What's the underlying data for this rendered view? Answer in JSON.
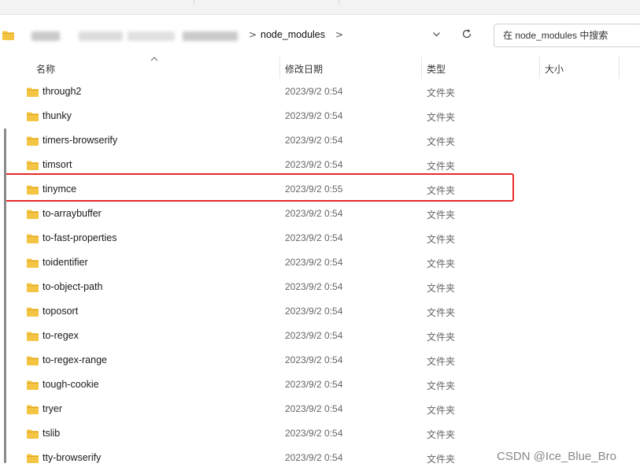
{
  "address": {
    "breadcrumb_current": "node_modules",
    "separator": ">",
    "dropdown_icon": "chevron-down-icon",
    "refresh_icon": "refresh-icon"
  },
  "search": {
    "placeholder": "在 node_modules 中搜索"
  },
  "columns": {
    "name": "名称",
    "modified": "修改日期",
    "type": "类型",
    "size": "大小"
  },
  "files": [
    {
      "name": "through2",
      "modified": "2023/9/2 0:54",
      "type": "文件夹"
    },
    {
      "name": "thunky",
      "modified": "2023/9/2 0:54",
      "type": "文件夹"
    },
    {
      "name": "timers-browserify",
      "modified": "2023/9/2 0:54",
      "type": "文件夹"
    },
    {
      "name": "timsort",
      "modified": "2023/9/2 0:54",
      "type": "文件夹"
    },
    {
      "name": "tinymce",
      "modified": "2023/9/2 0:55",
      "type": "文件夹"
    },
    {
      "name": "to-arraybuffer",
      "modified": "2023/9/2 0:54",
      "type": "文件夹"
    },
    {
      "name": "to-fast-properties",
      "modified": "2023/9/2 0:54",
      "type": "文件夹"
    },
    {
      "name": "toidentifier",
      "modified": "2023/9/2 0:54",
      "type": "文件夹"
    },
    {
      "name": "to-object-path",
      "modified": "2023/9/2 0:54",
      "type": "文件夹"
    },
    {
      "name": "toposort",
      "modified": "2023/9/2 0:54",
      "type": "文件夹"
    },
    {
      "name": "to-regex",
      "modified": "2023/9/2 0:54",
      "type": "文件夹"
    },
    {
      "name": "to-regex-range",
      "modified": "2023/9/2 0:54",
      "type": "文件夹"
    },
    {
      "name": "tough-cookie",
      "modified": "2023/9/2 0:54",
      "type": "文件夹"
    },
    {
      "name": "tryer",
      "modified": "2023/9/2 0:54",
      "type": "文件夹"
    },
    {
      "name": "tslib",
      "modified": "2023/9/2 0:54",
      "type": "文件夹"
    },
    {
      "name": "tty-browserify",
      "modified": "2023/9/2 0:54",
      "type": "文件夹"
    }
  ],
  "highlighted_item": "tinymce",
  "colors": {
    "folder": "#f4c542",
    "folder_dark": "#e0a82e",
    "highlight_border": "#e8292a"
  },
  "watermark": "CSDN @Ice_Blue_Bro"
}
